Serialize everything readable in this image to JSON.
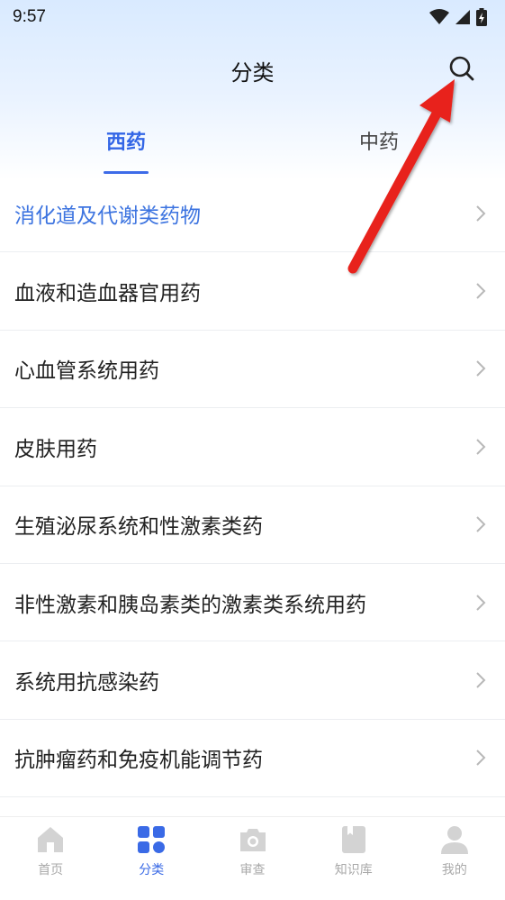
{
  "status_bar": {
    "time": "9:57"
  },
  "header": {
    "title": "分类"
  },
  "tabs": [
    {
      "label": "西药",
      "active": true
    },
    {
      "label": "中药",
      "active": false
    }
  ],
  "categories": [
    {
      "label": "消化道及代谢类药物",
      "active": true
    },
    {
      "label": "血液和造血器官用药",
      "active": false
    },
    {
      "label": "心血管系统用药",
      "active": false
    },
    {
      "label": "皮肤用药",
      "active": false
    },
    {
      "label": "生殖泌尿系统和性激素类药",
      "active": false
    },
    {
      "label": "非性激素和胰岛素类的激素类系统用药",
      "active": false
    },
    {
      "label": "系统用抗感染药",
      "active": false
    },
    {
      "label": "抗肿瘤药和免疫机能调节药",
      "active": false
    }
  ],
  "bottom_nav": [
    {
      "label": "首页",
      "icon": "home-icon",
      "active": false
    },
    {
      "label": "分类",
      "icon": "category-grid-icon",
      "active": true
    },
    {
      "label": "审查",
      "icon": "camera-scan-icon",
      "active": false
    },
    {
      "label": "知识库",
      "icon": "book-icon",
      "active": false
    },
    {
      "label": "我的",
      "icon": "user-icon",
      "active": false
    }
  ],
  "colors": {
    "accent": "#3d6be8",
    "active_text": "#3d74e0",
    "inactive_icon": "#d3d3d3",
    "annotation_arrow": "#e8231e"
  }
}
